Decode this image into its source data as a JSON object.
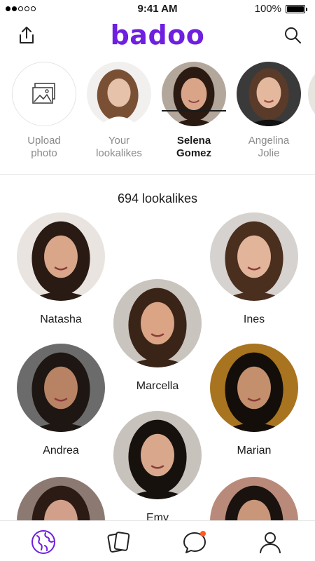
{
  "status_bar": {
    "time": "9:41 AM",
    "battery": "100%"
  },
  "header": {
    "brand": "badoo",
    "left_icon": "upload-icon",
    "right_icon": "search-icon"
  },
  "categories": [
    {
      "label": "Upload photo",
      "line1": "Upload",
      "line2": "photo",
      "active": false
    },
    {
      "label": "Your lookalikes",
      "line1": "Your",
      "line2": "lookalikes",
      "active": false
    },
    {
      "label": "Selena Gomez",
      "line1": "Selena",
      "line2": "Gomez",
      "active": true
    },
    {
      "label": "Angelina Jolie",
      "line1": "Angelina",
      "line2": "Jolie",
      "active": false
    }
  ],
  "results": {
    "count_label": "694 lookalikes"
  },
  "people": [
    {
      "name": "Natasha",
      "bg": "#e9e4df",
      "hair": "#2a1a14",
      "skin": "#d9a68a"
    },
    {
      "name": "Ines",
      "bg": "#d6d2cf",
      "hair": "#4a2e1e",
      "skin": "#e2b49a"
    },
    {
      "name": "Marcella",
      "bg": "#c9c4be",
      "hair": "#3a2418",
      "skin": "#dba585"
    },
    {
      "name": "Andrea",
      "bg": "#6b6b6b",
      "hair": "#1e1612",
      "skin": "#b88364"
    },
    {
      "name": "Marian",
      "bg": "#a8741f",
      "hair": "#140e0a",
      "skin": "#c48f6c"
    },
    {
      "name": "Emy",
      "bg": "#c7c2bc",
      "hair": "#17110e",
      "skin": "#d9a88c"
    },
    {
      "name": "",
      "bg": "#8c7a72",
      "hair": "#2b1b14",
      "skin": "#d2a08a"
    },
    {
      "name": "",
      "bg": "#b98a7a",
      "hair": "#1a120e",
      "skin": "#c9967a"
    }
  ],
  "bottom_nav": [
    {
      "icon": "globe-icon",
      "active": true
    },
    {
      "icon": "cards-icon",
      "active": false
    },
    {
      "icon": "chat-icon",
      "active": false,
      "badge": true
    },
    {
      "icon": "profile-icon",
      "active": false
    }
  ],
  "colors": {
    "brand": "#6e1fe0",
    "badge": "#ff5a1f",
    "active_nav": "#6e1fe0"
  }
}
